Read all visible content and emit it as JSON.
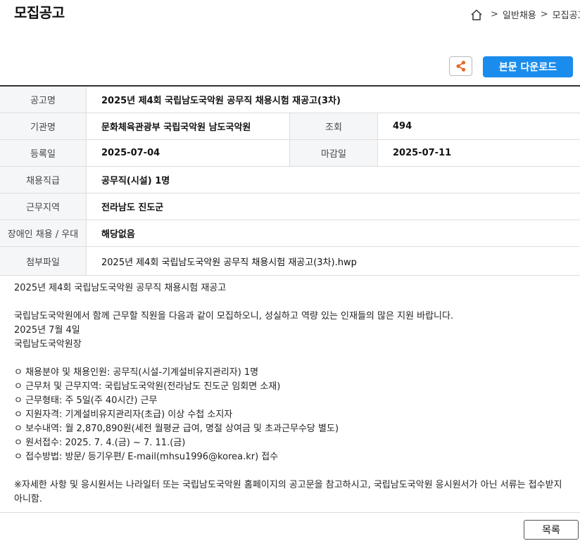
{
  "header": {
    "title": "모집공고",
    "breadcrumb": [
      "일반채용",
      "모집공고"
    ]
  },
  "toolbar": {
    "download_label": "본문 다운로드"
  },
  "details": {
    "notice_name_label": "공고명",
    "notice_name": "2025년 제4회 국립남도국악원 공무직 채용시험 재공고(3차)",
    "org_label": "기관명",
    "org": "문화체육관광부 국립국악원 남도국악원",
    "views_label": "조회",
    "views": "494",
    "reg_date_label": "등록일",
    "reg_date": "2025-07-04",
    "deadline_label": "마감일",
    "deadline": "2025-07-11",
    "grade_label": "채용직급",
    "grade": "공무직(시설) 1명",
    "region_label": "근무지역",
    "region": "전라남도 진도군",
    "disability_label": "장애인 채용 / 우대",
    "disability": "해당없음",
    "attachment_label": "첨부파일",
    "attachment": "2025년 제4회 국립남도국악원 공무직 채용시험 재공고(3차).hwp"
  },
  "body": {
    "heading": "2025년 제4회 국립남도국악원 공무직 채용시험 재공고",
    "intro": "국립남도국악원에서 함께 근무할 직원을 다음과 같이 모집하오니, 성실하고 역량 있는 인재들의 많은 지원 바랍니다.",
    "date": "2025년 7월 4일",
    "signer": "국립남도국악원장",
    "items": [
      "ㅇ 채용분야 및 채용인원: 공무직(시설-기계설비유지관리자) 1명",
      "ㅇ 근무처 및 근무지역: 국립남도국악원(전라남도 진도군 임회면 소재)",
      "ㅇ 근무형태: 주 5일(주 40시간) 근무",
      "ㅇ 지원자격: 기계설비유지관리자(초급) 이상 수첩 소지자",
      "ㅇ 보수내역: 월 2,870,890원(세전 월평균 급여, 명절 상여금 및 초과근무수당 별도)",
      "ㅇ 원서접수: 2025. 7. 4.(금) ~ 7. 11.(금)",
      "ㅇ 접수방법: 방문/ 등기우편/ E-mail(mhsu1996@korea.kr) 접수"
    ],
    "note": "※자세한 사항 및 응시원서는 나라일터 또는 국립남도국악원 홈페이지의 공고문을 참고하시고, 국립남도국악원 응시원서가 아닌 서류는 접수받지 아니함."
  },
  "footer": {
    "list_label": "목록"
  }
}
